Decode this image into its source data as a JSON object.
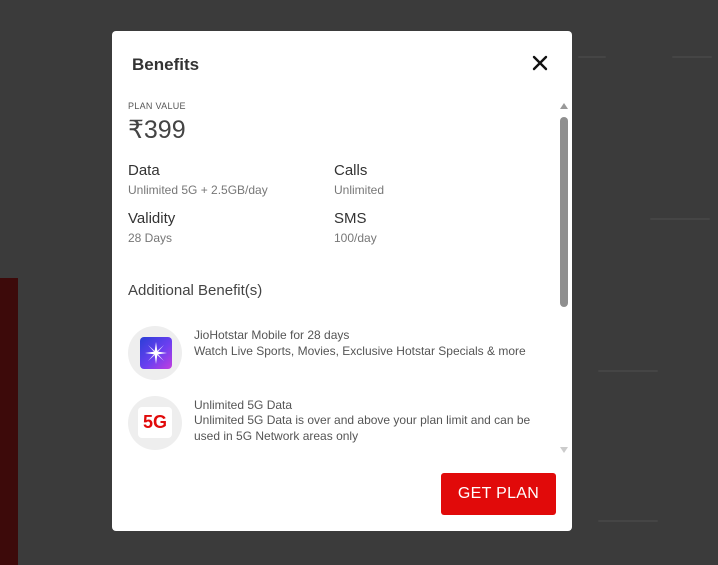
{
  "modal": {
    "title": "Benefits",
    "close_icon": "close-icon",
    "plan_value_label": "PLAN VALUE",
    "plan_price": "₹399",
    "stats": {
      "data": {
        "title": "Data",
        "value": "Unlimited 5G + 2.5GB/day"
      },
      "calls": {
        "title": "Calls",
        "value": "Unlimited"
      },
      "validity": {
        "title": "Validity",
        "value": "28 Days"
      },
      "sms": {
        "title": "SMS",
        "value": "100/day"
      }
    },
    "additional_heading": "Additional Benefit(s)",
    "benefits": [
      {
        "icon": "jiohotstar-icon",
        "title": "JioHotstar Mobile for 28 days",
        "description": "Watch Live Sports, Movies, Exclusive Hotstar Specials & more"
      },
      {
        "icon": "5g-icon",
        "icon_text": "5G",
        "title": "Unlimited 5G Data",
        "description": "Unlimited 5G Data is over and above your plan limit and can be used in 5G Network areas only"
      }
    ],
    "cta_label": "GET PLAN"
  },
  "colors": {
    "accent": "#e10a0a",
    "overlay": "#3b3b3b"
  }
}
